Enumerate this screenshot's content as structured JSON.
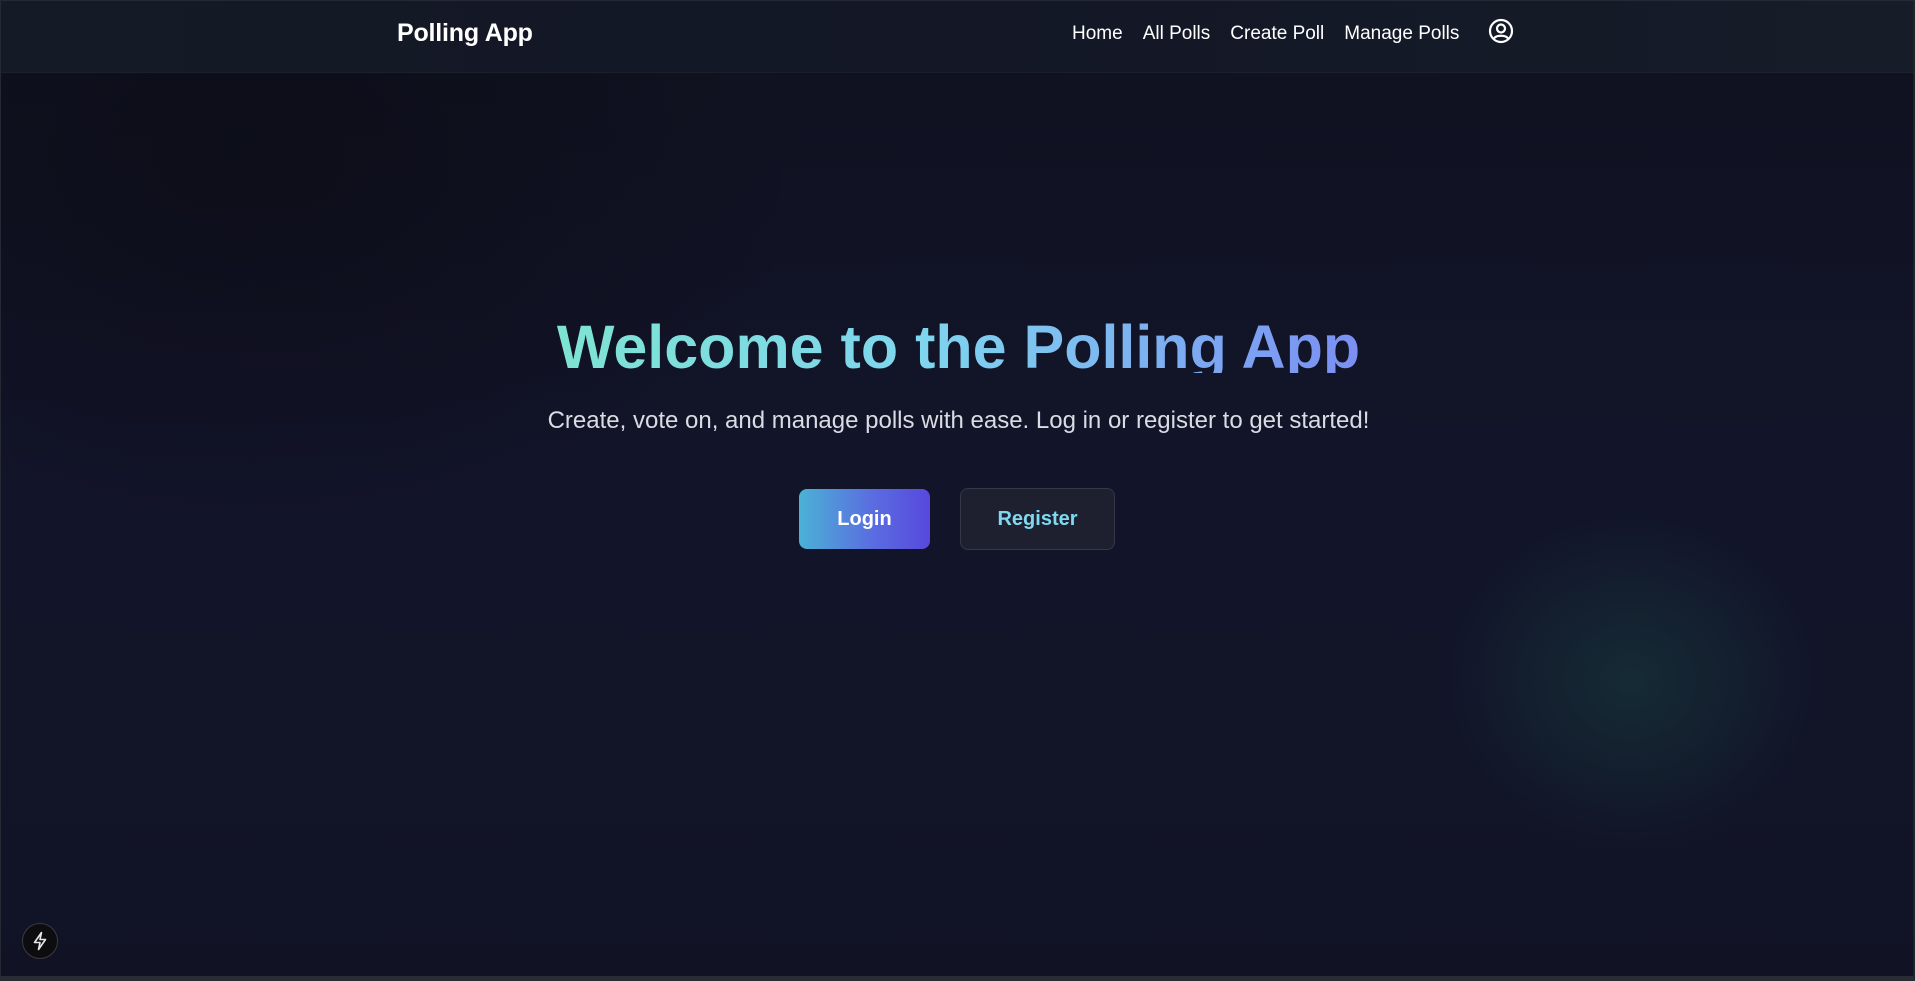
{
  "navbar": {
    "brand": "Polling App",
    "links": [
      {
        "label": "Home"
      },
      {
        "label": "All Polls"
      },
      {
        "label": "Create Poll"
      },
      {
        "label": "Manage Polls"
      }
    ],
    "profile_icon": "user-circle-icon"
  },
  "hero": {
    "title": "Welcome to the Polling App",
    "subtitle": "Create, vote on, and manage polls with ease. Log in or register to get started!",
    "login_label": "Login",
    "register_label": "Register"
  },
  "dev_tools": {
    "icon": "lightning-bolt-icon"
  },
  "colors": {
    "background": "#111322",
    "navbar": "#141a26",
    "title_gradient_start": "#7ee3d2",
    "title_gradient_end": "#7b8ff3",
    "login_gradient_start": "#4ab2d6",
    "login_gradient_end": "#5848dd",
    "register_text": "#7fd8f0"
  }
}
